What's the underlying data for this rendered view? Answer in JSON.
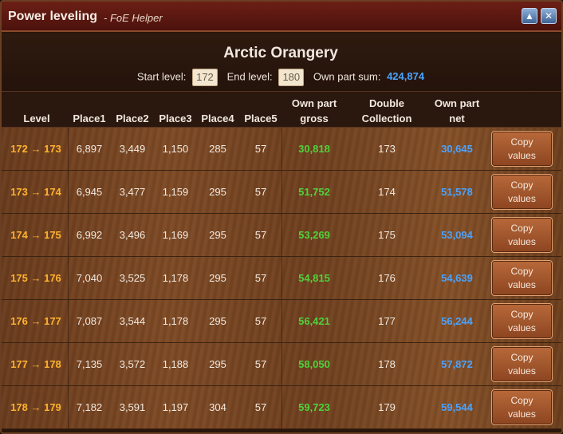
{
  "window": {
    "title": "Power leveling",
    "subtitle": "- FoE Helper",
    "minimize_glyph": "▲",
    "close_glyph": "✕"
  },
  "info": {
    "building_name": "Arctic Orangery",
    "start_label": "Start level:",
    "start_value": "172",
    "end_label": "End level:",
    "end_value": "180",
    "sum_label": "Own part sum:",
    "sum_value": "424,874"
  },
  "columns": {
    "level": "Level",
    "place1": "Place1",
    "place2": "Place2",
    "place3": "Place3",
    "place4": "Place4",
    "place5": "Place5",
    "gross_1": "Own part",
    "gross_2": "gross",
    "double_1": "Double",
    "double_2": "Collection",
    "net_1": "Own part",
    "net_2": "net"
  },
  "copy_label_1": "Copy",
  "copy_label_2": "values",
  "rows": [
    {
      "level": "172 → 173",
      "p1": "6,897",
      "p2": "3,449",
      "p3": "1,150",
      "p4": "285",
      "p5": "57",
      "gross": "30,818",
      "double": "173",
      "net": "30,645"
    },
    {
      "level": "173 → 174",
      "p1": "6,945",
      "p2": "3,477",
      "p3": "1,159",
      "p4": "295",
      "p5": "57",
      "gross": "51,752",
      "double": "174",
      "net": "51,578"
    },
    {
      "level": "174 → 175",
      "p1": "6,992",
      "p2": "3,496",
      "p3": "1,169",
      "p4": "295",
      "p5": "57",
      "gross": "53,269",
      "double": "175",
      "net": "53,094"
    },
    {
      "level": "175 → 176",
      "p1": "7,040",
      "p2": "3,525",
      "p3": "1,178",
      "p4": "295",
      "p5": "57",
      "gross": "54,815",
      "double": "176",
      "net": "54,639"
    },
    {
      "level": "176 → 177",
      "p1": "7,087",
      "p2": "3,544",
      "p3": "1,178",
      "p4": "295",
      "p5": "57",
      "gross": "56,421",
      "double": "177",
      "net": "56,244"
    },
    {
      "level": "177 → 178",
      "p1": "7,135",
      "p2": "3,572",
      "p3": "1,188",
      "p4": "295",
      "p5": "57",
      "gross": "58,050",
      "double": "178",
      "net": "57,872"
    },
    {
      "level": "178 → 179",
      "p1": "7,182",
      "p2": "3,591",
      "p3": "1,197",
      "p4": "304",
      "p5": "57",
      "gross": "59,723",
      "double": "179",
      "net": "59,544"
    }
  ],
  "colors": {
    "level": "#ffb22e",
    "gross": "#4fd13b",
    "net": "#4aa3ff"
  }
}
